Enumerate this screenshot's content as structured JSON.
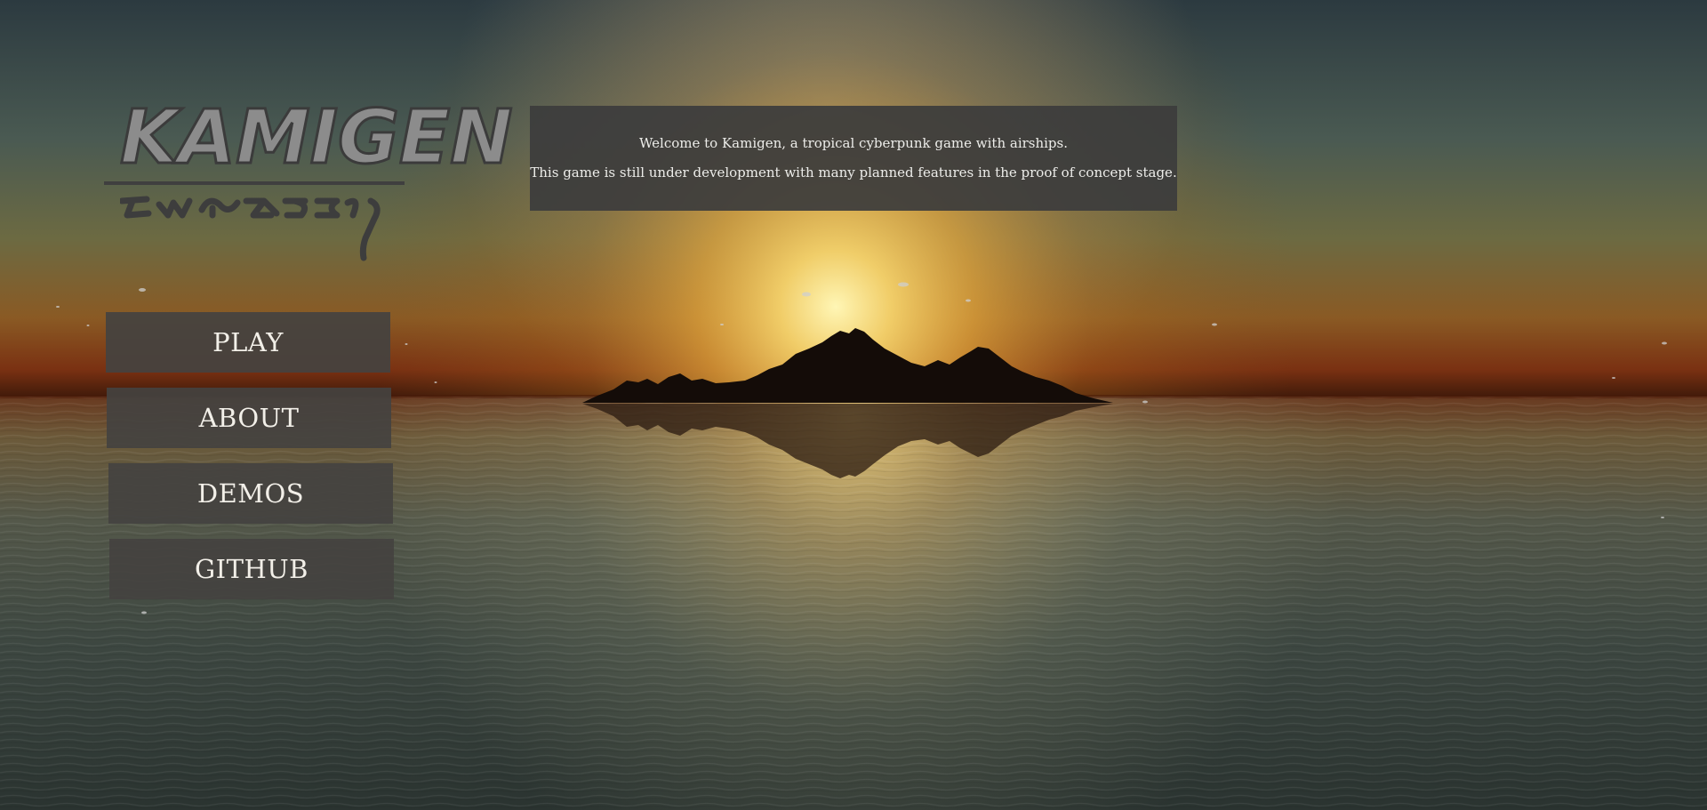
{
  "game": {
    "title": "KAMIGEN"
  },
  "menu": {
    "play_label": "PLAY",
    "about_label": "ABOUT",
    "demos_label": "DEMOS",
    "github_label": "GITHUB"
  },
  "welcome": {
    "line1": "Welcome to Kamigen, a tropical cyberpunk game with airships.",
    "line2": "This game is still under development with many planned features in the proof of concept stage."
  },
  "colors": {
    "panel": "#3c3c3c",
    "button": "#444240",
    "text": "#f2efe8",
    "sun": "#f6c94a",
    "horizon": "#c0561a",
    "sea": "#3a4540"
  }
}
